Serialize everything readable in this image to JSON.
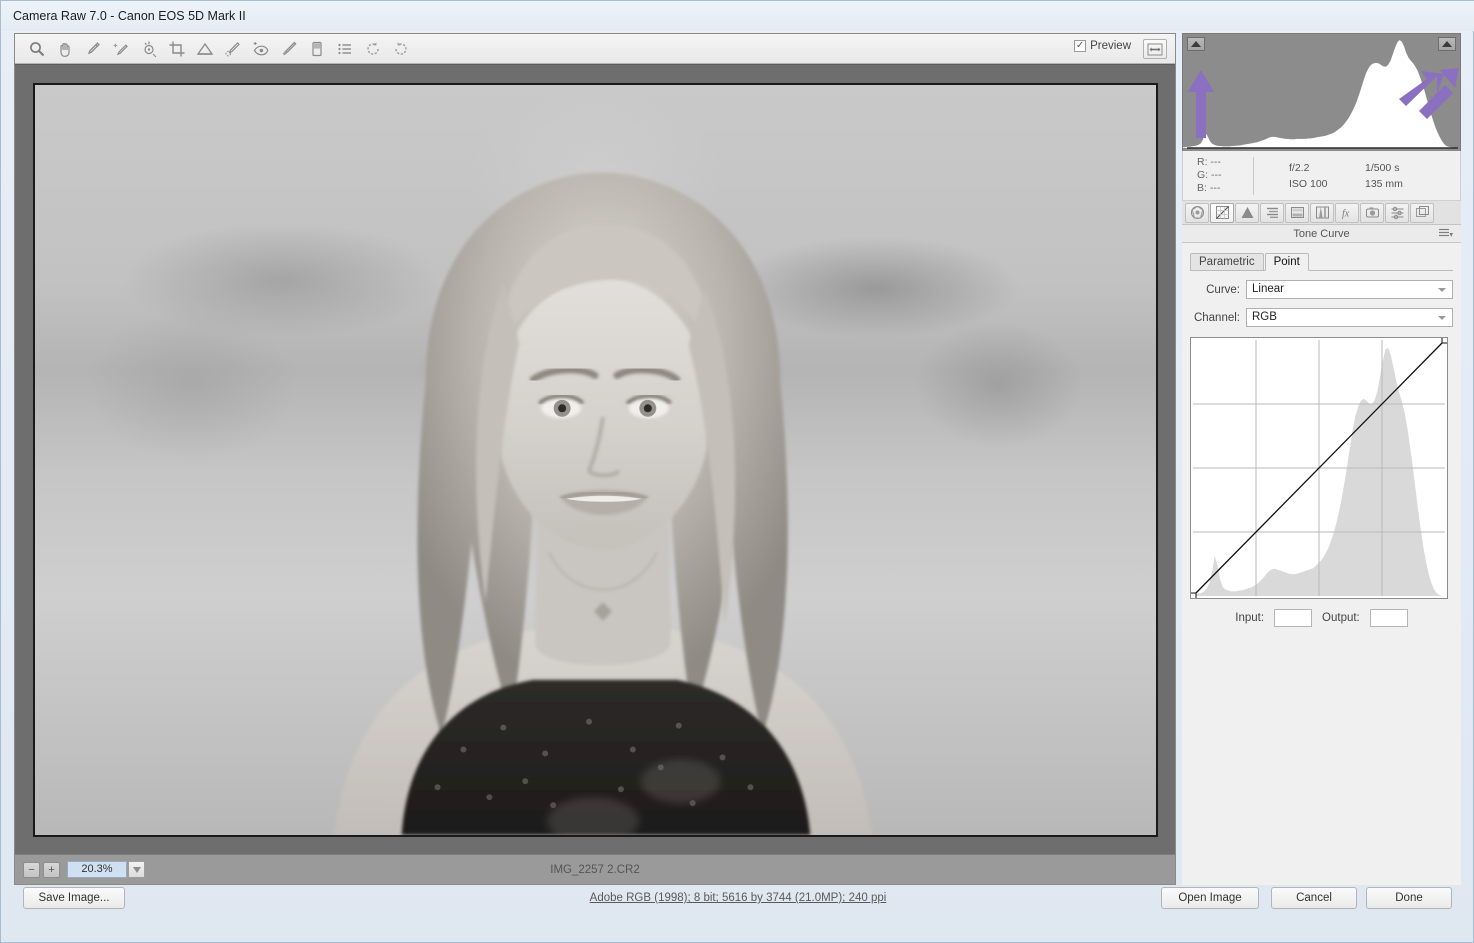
{
  "window": {
    "title": "Camera Raw 7.0  -  Canon EOS 5D Mark II"
  },
  "toolbar": {
    "tools": [
      {
        "name": "zoom-tool",
        "label": "Zoom Tool"
      },
      {
        "name": "hand-tool",
        "label": "Hand Tool"
      },
      {
        "name": "white-balance-tool",
        "label": "White Balance Tool"
      },
      {
        "name": "color-sampler-tool",
        "label": "Color Sampler Tool"
      },
      {
        "name": "targeted-adjustment-tool",
        "label": "Targeted Adjustment Tool"
      },
      {
        "name": "crop-tool",
        "label": "Crop Tool"
      },
      {
        "name": "straighten-tool",
        "label": "Straighten Tool"
      },
      {
        "name": "spot-removal-tool",
        "label": "Spot Removal"
      },
      {
        "name": "red-eye-removal-tool",
        "label": "Red Eye Removal"
      },
      {
        "name": "adjustment-brush-tool",
        "label": "Adjustment Brush"
      },
      {
        "name": "graduated-filter-tool",
        "label": "Graduated Filter"
      },
      {
        "name": "open-preferences-tool",
        "label": "Open Preferences Dialog"
      },
      {
        "name": "rotate-counterclockwise-tool",
        "label": "Rotate Image 90° Counter Clockwise"
      },
      {
        "name": "rotate-clockwise-tool",
        "label": "Rotate Image 90° Clockwise"
      }
    ],
    "preview_label": "Preview",
    "preview_checked": true,
    "preview_check_glyph": "✓",
    "fullscreen_label": "Toggle Full Screen Mode"
  },
  "preview": {
    "filename": "IMG_2257 2.CR2",
    "zoom_level": "20.3%",
    "zoom_out_label": "−",
    "zoom_in_label": "+"
  },
  "histogram": {
    "clip_shadow_label": "Shadow clipping warning",
    "clip_highlight_label": "Highlight clipping warning",
    "annotation_color": "#8b6fc0",
    "background_color": "#8c8c8c",
    "data": [
      2,
      2,
      3,
      3,
      4,
      5,
      6,
      8,
      12,
      22,
      38,
      30,
      18,
      11,
      8,
      6,
      5,
      5,
      4,
      4,
      4,
      4,
      5,
      5,
      6,
      6,
      7,
      8,
      9,
      10,
      11,
      12,
      13,
      14,
      16,
      18,
      20,
      22,
      25,
      27,
      28,
      28,
      27,
      26,
      25,
      24,
      23,
      23,
      22,
      22,
      22,
      23,
      23,
      23,
      23,
      23,
      24,
      24,
      25,
      26,
      27,
      28,
      29,
      30,
      31,
      33,
      35,
      37,
      40,
      44,
      48,
      53,
      59,
      66,
      74,
      83,
      94,
      106,
      120,
      136,
      154,
      172,
      188,
      200,
      208,
      212,
      214,
      214,
      212,
      208,
      205,
      205,
      210,
      220,
      236,
      252,
      266,
      272,
      268,
      256,
      240,
      228,
      220,
      214,
      206,
      196,
      182,
      166,
      148,
      128,
      108,
      88,
      70,
      54,
      40,
      28,
      18,
      10,
      5,
      3,
      2,
      1,
      1,
      0,
      0,
      0
    ]
  },
  "exif": {
    "r_label": "R:",
    "g_label": "G:",
    "b_label": "B:",
    "r_value": "---",
    "g_value": "---",
    "b_value": "---",
    "aperture": "f/2.2",
    "shutter": "1/500 s",
    "iso": "ISO 100",
    "focal_length": "135 mm"
  },
  "panels": {
    "tabs": [
      {
        "name": "panel-tab-basic",
        "label": "Basic",
        "active": false
      },
      {
        "name": "panel-tab-tone-curve",
        "label": "Tone Curve",
        "active": true
      },
      {
        "name": "panel-tab-detail",
        "label": "Detail",
        "active": false
      },
      {
        "name": "panel-tab-hsl-grayscale",
        "label": "HSL / Grayscale",
        "active": false
      },
      {
        "name": "panel-tab-split-toning",
        "label": "Split Toning",
        "active": false
      },
      {
        "name": "panel-tab-lens-corrections",
        "label": "Lens Corrections",
        "active": false
      },
      {
        "name": "panel-tab-effects",
        "label": "Effects",
        "active": false
      },
      {
        "name": "panel-tab-camera-calibration",
        "label": "Camera Calibration",
        "active": false
      },
      {
        "name": "panel-tab-presets",
        "label": "Presets",
        "active": false
      },
      {
        "name": "panel-tab-snapshots",
        "label": "Snapshots",
        "active": false
      }
    ],
    "active_title": "Tone Curve",
    "menu_label": "Panel Menu"
  },
  "tone_curve": {
    "tab_parametric": "Parametric",
    "tab_point": "Point",
    "active_tab": "Point",
    "curve_label": "Curve:",
    "curve_value": "Linear",
    "channel_label": "Channel:",
    "channel_value": "RGB",
    "input_label": "Input:",
    "input_value": "",
    "output_label": "Output:",
    "output_value": ""
  },
  "chart_data": {
    "type": "line",
    "title": "Tone Curve (Point)",
    "xlabel": "Input",
    "ylabel": "Output",
    "xlim": [
      0,
      255
    ],
    "ylim": [
      0,
      255
    ],
    "grid": true,
    "grid_divisions": 4,
    "curve_name": "Linear",
    "channel": "RGB",
    "points": [
      {
        "input": 0,
        "output": 0
      },
      {
        "input": 255,
        "output": 255
      }
    ],
    "background_histogram": [
      2,
      2,
      3,
      3,
      5,
      8,
      14,
      26,
      44,
      34,
      18,
      10,
      7,
      6,
      5,
      5,
      5,
      6,
      6,
      7,
      8,
      9,
      10,
      12,
      14,
      17,
      20,
      24,
      27,
      29,
      30,
      29,
      28,
      27,
      26,
      25,
      24,
      24,
      24,
      25,
      26,
      27,
      28,
      29,
      30,
      32,
      35,
      38,
      42,
      47,
      53,
      61,
      70,
      81,
      94,
      109,
      126,
      145,
      165,
      183,
      198,
      208,
      214,
      216,
      214,
      211,
      210,
      214,
      224,
      240,
      257,
      270,
      272,
      264,
      250,
      236,
      224,
      214,
      202,
      186,
      166,
      144,
      120,
      96,
      74,
      54,
      38,
      24,
      14,
      7,
      3,
      1,
      0,
      0
    ]
  },
  "bottom": {
    "save_image_label": "Save Image...",
    "workflow_options": "Adobe RGB (1998); 8 bit; 5616 by 3744 (21.0MP); 240 ppi",
    "open_image_label": "Open Image",
    "cancel_label": "Cancel",
    "done_label": "Done"
  }
}
